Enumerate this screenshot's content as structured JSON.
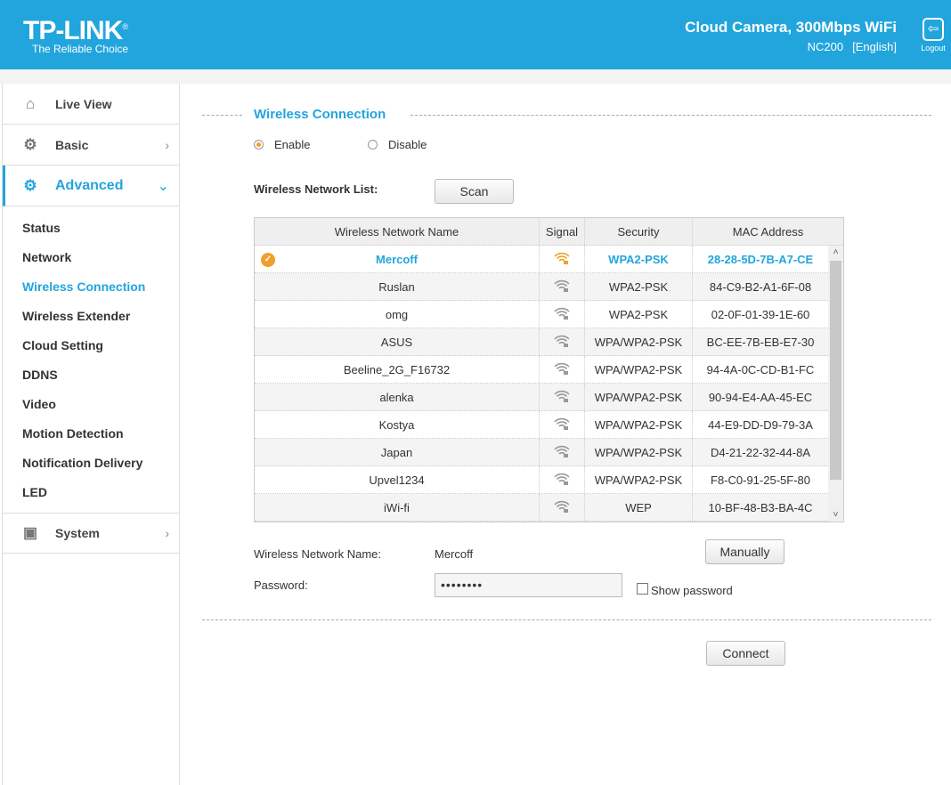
{
  "header": {
    "brand": "TP-LINK",
    "tagline": "The Reliable Choice",
    "product": "Cloud Camera, 300Mbps WiFi",
    "model": "NC200",
    "language": "[English]",
    "logout": "Logout"
  },
  "sidebar": {
    "main": [
      {
        "label": "Live View",
        "icon": "home-icon"
      },
      {
        "label": "Basic",
        "icon": "gear-icon"
      },
      {
        "label": "Advanced",
        "icon": "gears-icon"
      }
    ],
    "sub": [
      "Status",
      "Network",
      "Wireless Connection",
      "Wireless Extender",
      "Cloud Setting",
      "DDNS",
      "Video",
      "Motion Detection",
      "Notification Delivery",
      "LED"
    ],
    "system": "System"
  },
  "main": {
    "title": "Wireless Connection",
    "enable": "Enable",
    "disable": "Disable",
    "list_label": "Wireless Network List:",
    "scan": "Scan",
    "columns": [
      "Wireless Network Name",
      "Signal",
      "Security",
      "MAC Address"
    ],
    "networks": [
      {
        "name": "Mercoff",
        "security": "WPA2-PSK",
        "mac": "28-28-5D-7B-A7-CE"
      },
      {
        "name": "Ruslan",
        "security": "WPA2-PSK",
        "mac": "84-C9-B2-A1-6F-08"
      },
      {
        "name": "omg",
        "security": "WPA2-PSK",
        "mac": "02-0F-01-39-1E-60"
      },
      {
        "name": "ASUS",
        "security": "WPA/WPA2-PSK",
        "mac": "BC-EE-7B-EB-E7-30"
      },
      {
        "name": "Beeline_2G_F16732",
        "security": "WPA/WPA2-PSK",
        "mac": "94-4A-0C-CD-B1-FC"
      },
      {
        "name": "alenka",
        "security": "WPA/WPA2-PSK",
        "mac": "90-94-E4-AA-45-EC"
      },
      {
        "name": "Kostya",
        "security": "WPA/WPA2-PSK",
        "mac": "44-E9-DD-D9-79-3A"
      },
      {
        "name": "Japan",
        "security": "WPA/WPA2-PSK",
        "mac": "D4-21-22-32-44-8A"
      },
      {
        "name": "Upvel1234",
        "security": "WPA/WPA2-PSK",
        "mac": "F8-C0-91-25-5F-80"
      },
      {
        "name": "iWi-fi",
        "security": "WEP",
        "mac": "10-BF-48-B3-BA-4C"
      }
    ],
    "name_label": "Wireless Network Name:",
    "name_value": "Mercoff",
    "manually": "Manually",
    "password_label": "Password:",
    "password_value": "••••••••",
    "show_password": "Show password",
    "connect": "Connect"
  },
  "colors": {
    "accent": "#22a5dd",
    "selected": "#f0a02a"
  }
}
